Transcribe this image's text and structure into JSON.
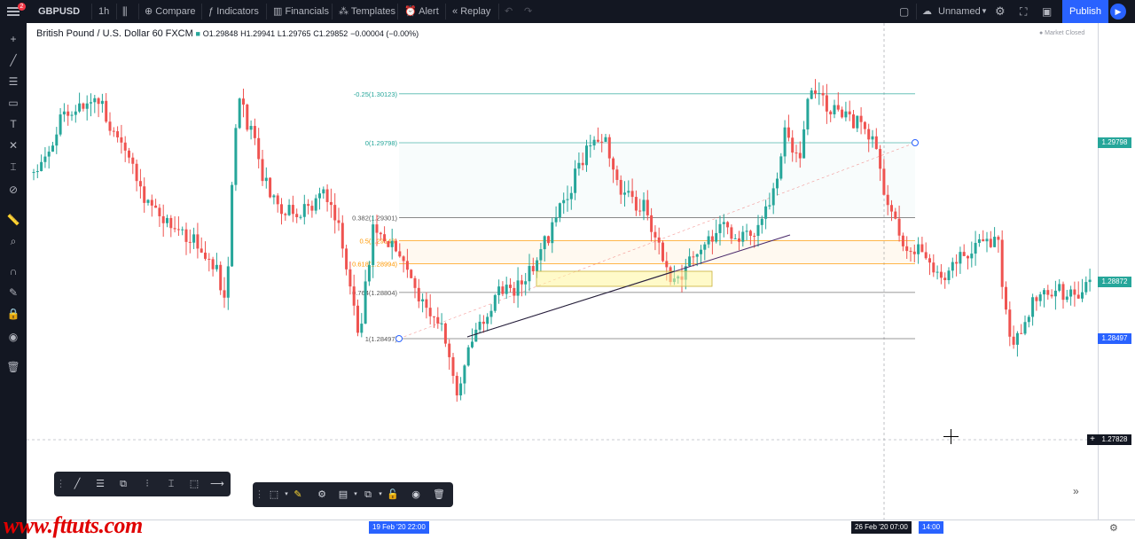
{
  "topbar": {
    "symbol": "GBPUSD",
    "interval": "1h",
    "compare": "Compare",
    "indicators": "Indicators",
    "financials": "Financials",
    "templates": "Templates",
    "alert": "Alert",
    "replay": "Replay",
    "layout_name": "Unnamed",
    "publish": "Publish",
    "notifications": "2"
  },
  "legend": {
    "name": "British Pound / U.S. Dollar",
    "interval": "60",
    "exchange": "FXCM",
    "open": "O1.29848",
    "high": "H1.29941",
    "low": "L1.29765",
    "close": "C1.29852",
    "change": "−0.00004 (−0.00%)",
    "market_status": "● Market Closed"
  },
  "fib_levels": [
    {
      "label": "-0.25(1.30123)",
      "price": 1.30123,
      "color": "#26a69a"
    },
    {
      "label": "0(1.29798)",
      "price": 1.29798,
      "color": "#26a69a"
    },
    {
      "label": "0.382(1.29301)",
      "price": 1.29301,
      "color": "#555555"
    },
    {
      "label": "0.5(1.29148)",
      "price": 1.29148,
      "color": "#ff9800"
    },
    {
      "label": "0.618(1.28994)",
      "price": 1.28994,
      "color": "#ff9800"
    },
    {
      "label": "0.764(1.28804)",
      "price": 1.28804,
      "color": "#555555"
    },
    {
      "label": "1(1.28497)",
      "price": 1.28497,
      "color": "#555555"
    }
  ],
  "price_labels": {
    "fib_zero": "1.29798",
    "current": "1.28872",
    "fib_one": "1.28497",
    "crosshair": "1.27828"
  },
  "time_labels": {
    "left": "19 Feb '20  22:00",
    "crosshair": "26 Feb '20  07:00",
    "right": "14:00"
  },
  "colors": {
    "up": "#26a69a",
    "down": "#ef5350",
    "accent": "#2962ff",
    "dark": "#131722"
  },
  "watermark": "www.fttuts.com",
  "chart_data": {
    "type": "candlestick",
    "symbol": "GBPUSD",
    "interval": "60",
    "levels": [
      1.30123,
      1.29798,
      1.29301,
      1.29148,
      1.28994,
      1.28804,
      1.28497
    ],
    "current_price": 1.28872
  }
}
